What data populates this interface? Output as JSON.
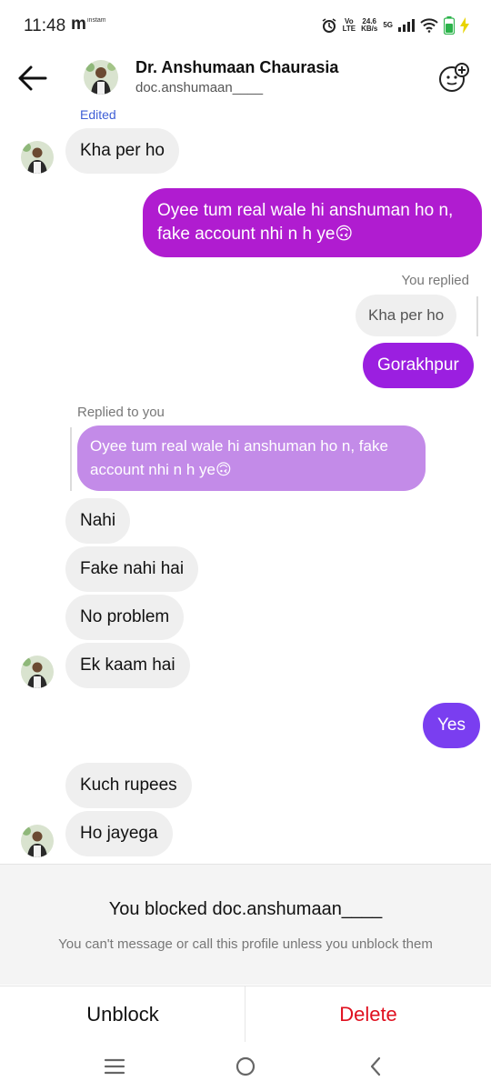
{
  "status": {
    "time": "11:48",
    "carrier_icon": "m",
    "mini_label": "instamart",
    "volte": "Vo\nLTE",
    "speed": "24.6\nKB/s",
    "network": "5G"
  },
  "header": {
    "name": "Dr. Anshumaan Chaurasia",
    "username": "doc.anshumaan____"
  },
  "messages": {
    "edited_label": "Edited",
    "m1": "Kha per ho",
    "m2": "Oyee tum real wale hi anshuman ho n, fake account nhi n h ye🙃",
    "you_replied_label": "You replied",
    "quoted_m1": "Kha per ho",
    "m3": "Gorakhpur",
    "replied_to_you_label": "Replied to you",
    "quoted_m2": "Oyee tum real wale hi anshuman ho n, fake account nhi n h ye🙃",
    "m4": "Nahi",
    "m5": "Fake nahi hai",
    "m6": "No problem",
    "m7": "Ek kaam hai",
    "m8": "Yes",
    "m9": "Kuch rupees",
    "m10": "Ho jayega"
  },
  "blocked": {
    "title": "You blocked doc.anshumaan____",
    "subtitle": "You can't message or call this profile unless you unblock them"
  },
  "actions": {
    "unblock": "Unblock",
    "delete": "Delete"
  },
  "colors": {
    "accent_magenta": "#b01cd0",
    "accent_purple": "#9b1fe0",
    "accent_violet": "#7a3ef0",
    "delete_red": "#e0101f",
    "edited_blue": "#3f5fd6"
  },
  "icons": [
    "back-arrow-icon",
    "add-people-icon",
    "menu-icon",
    "home-icon",
    "back-nav-icon",
    "alarm-icon",
    "wifi-icon",
    "signal-icon",
    "battery-icon"
  ]
}
